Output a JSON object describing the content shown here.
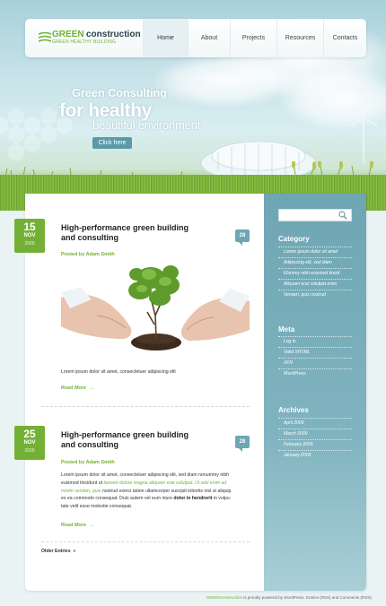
{
  "header": {
    "logo_green": "GREEN",
    "logo_construction": "construction",
    "logo_tagline": "GREEN HEALTHY BUILDING",
    "nav": [
      {
        "label": "Home",
        "active": true
      },
      {
        "label": "About",
        "active": false
      },
      {
        "label": "Projects",
        "active": false
      },
      {
        "label": "Resources",
        "active": false
      },
      {
        "label": "Contacts",
        "active": false
      }
    ]
  },
  "hero": {
    "line1": "Green Consulting",
    "line2": "for healthy",
    "line3": "beautiful environment",
    "cta": "Click here"
  },
  "posts": [
    {
      "day": "15",
      "month": "NOV",
      "year": "2009",
      "title_1": "High-performance green building",
      "title_2": "and consulting",
      "author": "Posted by Adam Smith",
      "comments": "28",
      "excerpt": "Lorem ipsum dolor sit amet, consectetuer adipiscing elit",
      "read_more": "Read More"
    },
    {
      "day": "25",
      "month": "NOV",
      "year": "2009",
      "title_1": "High-performance green building",
      "title_2": "and consulting",
      "author": "Posted by Adam Smith",
      "comments": "28",
      "body": [
        {
          "text": "Lorem ipsum dolor sit amet, consectetuer adipiscing elit, sed diam nonummy nibh",
          "hl": false
        },
        {
          "text": "euismod tincidunt ut",
          "hl": false,
          "tail_hl": " laoreet dolore magna aliquam erat volutpat. Ut wisi enim ad"
        },
        {
          "text": "minim veniam, quis",
          "hl": true,
          "tail": " nostrud exerci tation ullamcorper suscipit lobortis nisl ut aliquip"
        },
        {
          "text": "ex ea commodo consequat. Duis autem vel eum iriure",
          "hl": false,
          "tail_b": " dolor in hendrerit",
          "tail2": " in vulpu-"
        },
        {
          "text": "tate velit esse molestie consequat.",
          "hl": false
        }
      ],
      "read_more": "Read More"
    }
  ],
  "older": "Older Entries",
  "sidebar": {
    "search_placeholder": "",
    "category_title": "Category",
    "categories": [
      "Lorem ipsum dolor sit amet",
      "Adipiscing elit, sed diam",
      "Elommy nibh euismod tincid",
      "Aliquam erat volutpat enim",
      "Veniam, quis nostrud"
    ],
    "meta_title": "Meta",
    "meta": [
      "Log in",
      "Valid XHTML",
      "XFN",
      "WordPress"
    ],
    "archives_title": "Archives",
    "archives": [
      "April 2009",
      "March 2009",
      "February 2009",
      "January 2009"
    ]
  },
  "footer": {
    "brand": "GREENconstruction",
    "text": " is proudly powered by WordPress. Entries (RSS) and Comments (RSS)."
  },
  "colors": {
    "accent_green": "#74b035",
    "accent_teal": "#6fa6b3",
    "background": "#e9f3f4"
  }
}
